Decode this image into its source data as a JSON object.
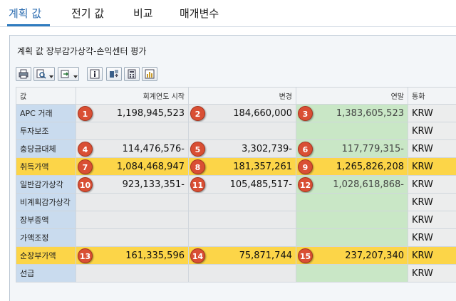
{
  "tabs": [
    "계획 값",
    "전기 값",
    "비교",
    "매개변수"
  ],
  "panel": {
    "title": "계획 값 장부감가상각-손익센터 평가"
  },
  "toolbar": [
    "print-icon",
    "preview-icon",
    "export-icon",
    "info-icon",
    "layout-icon",
    "calculator-icon",
    "chart-icon"
  ],
  "table": {
    "headers": {
      "label": "값",
      "start": "회계연도 시작",
      "change": "변경",
      "end": "연말",
      "currency": "통화"
    },
    "rows": [
      {
        "label": "APC 거래",
        "start": "1,198,945,523",
        "change": "184,660,000",
        "end": "1,383,605,523",
        "currency": "KRW",
        "badges": [
          "1",
          "2",
          "3"
        ],
        "highlight": false
      },
      {
        "label": "투자보조",
        "start": "",
        "change": "",
        "end": "",
        "currency": "KRW",
        "badges": [],
        "highlight": false
      },
      {
        "label": "충당금대체",
        "start": "114,476,576-",
        "change": "3,302,739-",
        "end": "117,779,315-",
        "currency": "KRW",
        "badges": [
          "4",
          "5",
          "6"
        ],
        "highlight": false
      },
      {
        "label": "취득가액",
        "start": "1,084,468,947",
        "change": "181,357,261",
        "end": "1,265,826,208",
        "currency": "KRW",
        "badges": [
          "7",
          "8",
          "9"
        ],
        "highlight": true
      },
      {
        "label": "일반감가상각",
        "start": "923,133,351-",
        "change": "105,485,517-",
        "end": "1,028,618,868-",
        "currency": "KRW",
        "badges": [
          "10",
          "11",
          "12"
        ],
        "highlight": false
      },
      {
        "label": "비계획감가상각",
        "start": "",
        "change": "",
        "end": "",
        "currency": "KRW",
        "badges": [],
        "highlight": false
      },
      {
        "label": "장부증액",
        "start": "",
        "change": "",
        "end": "",
        "currency": "KRW",
        "badges": [],
        "highlight": false
      },
      {
        "label": "가액조정",
        "start": "",
        "change": "",
        "end": "",
        "currency": "KRW",
        "badges": [],
        "highlight": false
      },
      {
        "label": "순장부가액",
        "start": "161,335,596",
        "change": "75,871,744",
        "end": "237,207,340",
        "currency": "KRW",
        "badges": [
          "13",
          "14",
          "15"
        ],
        "highlight": true
      },
      {
        "label": "선급",
        "start": "",
        "change": "",
        "end": "",
        "currency": "KRW",
        "badges": [],
        "highlight": false
      }
    ]
  },
  "colors": {
    "accent": "#2f7cc0",
    "highlight": "#fcd548",
    "end_col": "#c9e7c6",
    "label_col": "#c9dbee",
    "badge": "#d94f34"
  }
}
